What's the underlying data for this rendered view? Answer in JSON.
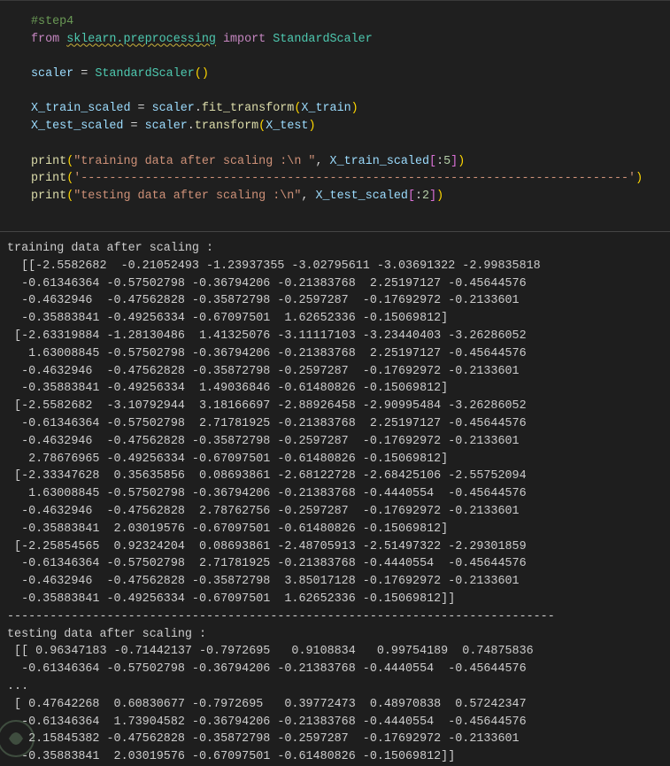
{
  "code_cell": {
    "lines": [
      [
        {
          "t": "#step4",
          "c": "cm"
        }
      ],
      [
        {
          "t": "from ",
          "c": "kw"
        },
        {
          "t": "sklearn.preprocessing",
          "c": "cls squig"
        },
        {
          "t": " ",
          "c": "op"
        },
        {
          "t": "import",
          "c": "kw"
        },
        {
          "t": " StandardScaler",
          "c": "cls"
        }
      ],
      [],
      [
        {
          "t": "scaler",
          "c": "var"
        },
        {
          "t": " = ",
          "c": "op"
        },
        {
          "t": "StandardScaler",
          "c": "cls"
        },
        {
          "t": "()",
          "c": "br1"
        }
      ],
      [],
      [
        {
          "t": "X_train_scaled",
          "c": "var"
        },
        {
          "t": " = ",
          "c": "op"
        },
        {
          "t": "scaler",
          "c": "var"
        },
        {
          "t": ".",
          "c": "op"
        },
        {
          "t": "fit_transform",
          "c": "fn"
        },
        {
          "t": "(",
          "c": "br1"
        },
        {
          "t": "X_train",
          "c": "var"
        },
        {
          "t": ")",
          "c": "br1"
        }
      ],
      [
        {
          "t": "X_test_scaled",
          "c": "var"
        },
        {
          "t": " = ",
          "c": "op"
        },
        {
          "t": "scaler",
          "c": "var"
        },
        {
          "t": ".",
          "c": "op"
        },
        {
          "t": "transform",
          "c": "fn"
        },
        {
          "t": "(",
          "c": "br1"
        },
        {
          "t": "X_test",
          "c": "var"
        },
        {
          "t": ")",
          "c": "br1"
        }
      ],
      [],
      [
        {
          "t": "print",
          "c": "fn"
        },
        {
          "t": "(",
          "c": "br1"
        },
        {
          "t": "\"training data after scaling :\\n \"",
          "c": "str"
        },
        {
          "t": ", ",
          "c": "op"
        },
        {
          "t": "X_train_scaled",
          "c": "var"
        },
        {
          "t": "[",
          "c": "br2"
        },
        {
          "t": ":",
          "c": "op"
        },
        {
          "t": "5",
          "c": "num"
        },
        {
          "t": "]",
          "c": "br2"
        },
        {
          "t": ")",
          "c": "br1"
        }
      ],
      [
        {
          "t": "print",
          "c": "fn"
        },
        {
          "t": "(",
          "c": "br1"
        },
        {
          "t": "'-----------------------------------------------------------------------------'",
          "c": "str"
        },
        {
          "t": ")",
          "c": "br1"
        }
      ],
      [
        {
          "t": "print",
          "c": "fn"
        },
        {
          "t": "(",
          "c": "br1"
        },
        {
          "t": "\"testing data after scaling :\\n\"",
          "c": "str"
        },
        {
          "t": ", ",
          "c": "op"
        },
        {
          "t": "X_test_scaled",
          "c": "var"
        },
        {
          "t": "[",
          "c": "br2"
        },
        {
          "t": ":",
          "c": "op"
        },
        {
          "t": "2",
          "c": "num"
        },
        {
          "t": "]",
          "c": "br2"
        },
        {
          "t": ")",
          "c": "br1"
        }
      ]
    ]
  },
  "output": {
    "lines": [
      "training data after scaling :",
      "  [[-2.5582682  -0.21052493 -1.23937355 -3.02795611 -3.03691322 -2.99835818",
      "  -0.61346364 -0.57502798 -0.36794206 -0.21383768  2.25197127 -0.45644576",
      "  -0.4632946  -0.47562828 -0.35872798 -0.2597287  -0.17692972 -0.2133601",
      "  -0.35883841 -0.49256334 -0.67097501  1.62652336 -0.15069812]",
      " [-2.63319884 -1.28130486  1.41325076 -3.11117103 -3.23440403 -3.26286052",
      "   1.63008845 -0.57502798 -0.36794206 -0.21383768  2.25197127 -0.45644576",
      "  -0.4632946  -0.47562828 -0.35872798 -0.2597287  -0.17692972 -0.2133601",
      "  -0.35883841 -0.49256334  1.49036846 -0.61480826 -0.15069812]",
      " [-2.5582682  -3.10792944  3.18166697 -2.88926458 -2.90995484 -3.26286052",
      "  -0.61346364 -0.57502798  2.71781925 -0.21383768  2.25197127 -0.45644576",
      "  -0.4632946  -0.47562828 -0.35872798 -0.2597287  -0.17692972 -0.2133601",
      "   2.78676965 -0.49256334 -0.67097501 -0.61480826 -0.15069812]",
      " [-2.33347628  0.35635856  0.08693861 -2.68122728 -2.68425106 -2.55752094",
      "   1.63008845 -0.57502798 -0.36794206 -0.21383768 -0.4440554  -0.45644576",
      "  -0.4632946  -0.47562828  2.78762756 -0.2597287  -0.17692972 -0.2133601",
      "  -0.35883841  2.03019576 -0.67097501 -0.61480826 -0.15069812]",
      " [-2.25854565  0.92324204  0.08693861 -2.48705913 -2.51497322 -2.29301859",
      "  -0.61346364 -0.57502798  2.71781925 -0.21383768 -0.4440554  -0.45644576",
      "  -0.4632946  -0.47562828 -0.35872798  3.85017128 -0.17692972 -0.2133601",
      "  -0.35883841 -0.49256334 -0.67097501  1.62652336 -0.15069812]]",
      "-----------------------------------------------------------------------------",
      "testing data after scaling :",
      " [[ 0.96347183 -0.71442137 -0.7972695   0.9108834   0.99754189  0.74875836",
      "  -0.61346364 -0.57502798 -0.36794206 -0.21383768 -0.4440554  -0.45644576",
      "...",
      " [ 0.47642268  0.60830677 -0.7972695   0.39772473  0.48970838  0.57242347",
      "  -0.61346364  1.73904582 -0.36794206 -0.21383768 -0.4440554  -0.45644576",
      "   2.15845382 -0.47562828 -0.35872798 -0.2597287  -0.17692972 -0.2133601",
      "  -0.35883841  2.03019576 -0.67097501 -0.61480826 -0.15069812]]"
    ]
  }
}
